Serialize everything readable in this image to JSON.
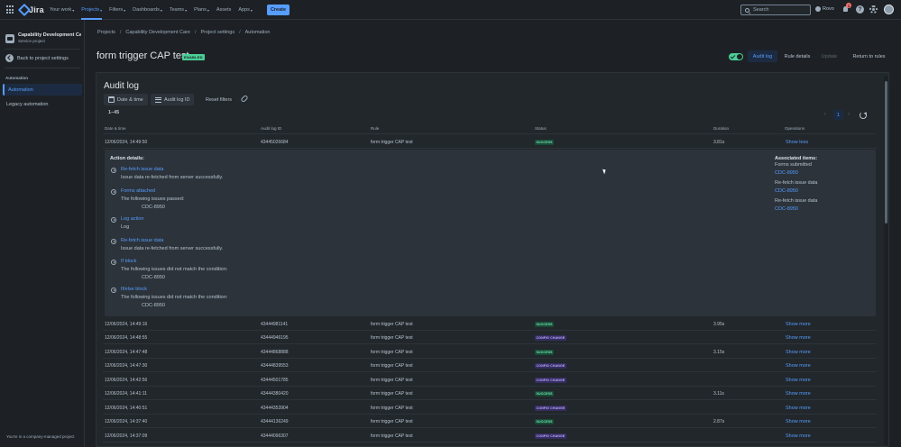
{
  "topnav": {
    "logo": "Jira",
    "menu": [
      {
        "label": "Your work",
        "active": false
      },
      {
        "label": "Projects",
        "active": true
      },
      {
        "label": "Filters",
        "active": false
      },
      {
        "label": "Dashboards",
        "active": false
      },
      {
        "label": "Teams",
        "active": false
      },
      {
        "label": "Plans",
        "active": false
      },
      {
        "label": "Assets",
        "active": false
      },
      {
        "label": "Apps",
        "active": false
      }
    ],
    "create_label": "Create",
    "search_placeholder": "Search",
    "rovo_label": "Rovo",
    "notif_count": "1",
    "help_label": "?"
  },
  "sidebar": {
    "project_name": "Capability Development Care",
    "project_type": "Service project",
    "back_label": "Back to project settings",
    "section_label": "Automation",
    "items": [
      {
        "label": "Automation",
        "active": true
      },
      {
        "label": "Legacy automation",
        "active": false
      }
    ],
    "footer": "You're in a company-managed project"
  },
  "breadcrumb": [
    "Projects",
    "Capability Development Care",
    "Project settings",
    "Automation"
  ],
  "rule": {
    "title": "form trigger CAP test",
    "status": "ENABLED"
  },
  "header_buttons": {
    "audit_log": "Audit log",
    "rule_details": "Rule details",
    "update": "Update",
    "return": "Return to rules"
  },
  "audit": {
    "title": "Audit log",
    "filters": {
      "date_time": "Date & time",
      "audit_log_id": "Audit log ID",
      "reset": "Reset filters"
    },
    "range": "1–45",
    "page": "1",
    "columns": [
      "Date & time",
      "Audit log ID",
      "Rule",
      "Status",
      "Duration",
      "Operations"
    ],
    "expanded_row": {
      "date": "12/06/2024, 14:49:50",
      "id": "43445026684",
      "rule": "form trigger CAP test",
      "status": "SUCCESS",
      "duration": "3.81s",
      "op": "Show less"
    },
    "action_details_title": "Action details:",
    "actions": [
      {
        "name": "Re-fetch issue data",
        "desc": "Issue data re-fetched from server successfully.",
        "sub": ""
      },
      {
        "name": "Forms attached",
        "desc": "The following issues passed:",
        "sub": "CDC-8950"
      },
      {
        "name": "Log action",
        "desc": "Log",
        "sub": ""
      },
      {
        "name": "Re-fetch issue data",
        "desc": "Issue data re-fetched from server successfully.",
        "sub": ""
      },
      {
        "name": "If block",
        "desc": "The following issues did not match the condition:",
        "sub": "CDC-8950"
      },
      {
        "name": "If/else block",
        "desc": "The following issues did not match the condition:",
        "sub": "CDC-8950"
      }
    ],
    "associated": {
      "title": "Associated items:",
      "items": [
        {
          "text": "Forms submitted",
          "link": "CDC-8950"
        },
        {
          "text": "Re-fetch issue data",
          "link": "CDC-8950"
        },
        {
          "text": "Re-fetch issue data",
          "link": "CDC-8950"
        }
      ]
    },
    "rows": [
      {
        "date": "12/06/2024, 14:49:16",
        "id": "43444981141",
        "rule": "form trigger CAP test",
        "status": "SUCCESS",
        "status_type": "success",
        "duration": "3.95s",
        "op": "Show more"
      },
      {
        "date": "12/06/2024, 14:48:55",
        "id": "43444946195",
        "rule": "form trigger CAP test",
        "status": "CONFIG CHANGE",
        "status_type": "config",
        "duration": "",
        "op": "Show more"
      },
      {
        "date": "12/06/2024, 14:47:48",
        "id": "43444868888",
        "rule": "form trigger CAP test",
        "status": "SUCCESS",
        "status_type": "success",
        "duration": "3.15s",
        "op": "Show more"
      },
      {
        "date": "12/06/2024, 14:47:30",
        "id": "43444839553",
        "rule": "form trigger CAP test",
        "status": "CONFIG CHANGE",
        "status_type": "config",
        "duration": "",
        "op": "Show more"
      },
      {
        "date": "12/06/2024, 14:42:56",
        "id": "43444501785",
        "rule": "form trigger CAP test",
        "status": "CONFIG CHANGE",
        "status_type": "config",
        "duration": "",
        "op": "Show more"
      },
      {
        "date": "12/06/2024, 14:41:11",
        "id": "43444380420",
        "rule": "form trigger CAP test",
        "status": "SUCCESS",
        "status_type": "success",
        "duration": "3.11s",
        "op": "Show more"
      },
      {
        "date": "12/06/2024, 14:40:51",
        "id": "43444353904",
        "rule": "form trigger CAP test",
        "status": "CONFIG CHANGE",
        "status_type": "config",
        "duration": "",
        "op": "Show more"
      },
      {
        "date": "12/06/2024, 14:37:40",
        "id": "43444136249",
        "rule": "form trigger CAP test",
        "status": "SUCCESS",
        "status_type": "success",
        "duration": "2.87s",
        "op": "Show more"
      },
      {
        "date": "12/06/2024, 14:37:09",
        "id": "43444096307",
        "rule": "form trigger CAP test",
        "status": "CONFIG CHANGE",
        "status_type": "config",
        "duration": "",
        "op": "Show more"
      }
    ]
  },
  "colors": {
    "accent": "#579dff",
    "success": "#4bce97",
    "config": "#9f8fef",
    "background": "#1d2125"
  }
}
